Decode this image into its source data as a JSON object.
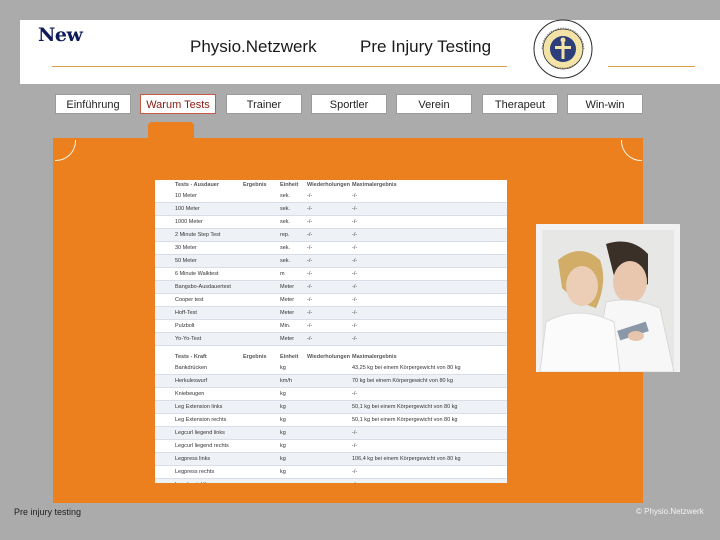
{
  "header": {
    "logo": "New",
    "title_left": "Physio.Netzwerk",
    "title_right": "Pre Injury Testing",
    "seal_text": "Physio.Netzwerk, Ihr Partner für Gesundheit"
  },
  "nav": [
    "Einführung",
    "Warum Tests",
    "Trainer",
    "Sportler",
    "Verein",
    "Therapeut",
    "Win-win"
  ],
  "nav_active": "Warum Tests",
  "table": {
    "section1_headers": [
      "Tests - Ausdauer",
      "Ergebnis",
      "Einheit",
      "Wiederholungen",
      "Maximalergebnis"
    ],
    "section1_rows": [
      [
        "10 Meter",
        "",
        "sek.",
        "-/-",
        "-/-"
      ],
      [
        "100 Meter",
        "",
        "sek.",
        "-/-",
        "-/-"
      ],
      [
        "1000 Meter",
        "",
        "sek.",
        "-/-",
        "-/-"
      ],
      [
        "2 Minute Step Test",
        "",
        "rep.",
        "-/-",
        "-/-"
      ],
      [
        "30 Meter",
        "",
        "sek.",
        "-/-",
        "-/-"
      ],
      [
        "50 Meter",
        "",
        "sek.",
        "-/-",
        "-/-"
      ],
      [
        "6 Minute Walktest",
        "",
        "m",
        "-/-",
        "-/-"
      ],
      [
        "Bangsbo-Ausdauertest",
        "",
        "Meter",
        "-/-",
        "-/-"
      ],
      [
        "Cooper test",
        "",
        "Meter",
        "-/-",
        "-/-"
      ],
      [
        "Hoff-Test",
        "",
        "Meter",
        "-/-",
        "-/-"
      ],
      [
        "Pulzbolt",
        "",
        "Min.",
        "-/-",
        "-/-"
      ],
      [
        "Yo-Yo-Test",
        "",
        "Meter",
        "-/-",
        "-/-"
      ]
    ],
    "section2_headers": [
      "Tests - Kraft",
      "Ergebnis",
      "Einheit",
      "Wiederholungen",
      "Maximalergebnis"
    ],
    "section2_rows": [
      [
        "Bankdrücken",
        "",
        "kg",
        "",
        "43,25 kg bei einem Körpergewicht von 80 kg"
      ],
      [
        "Herkuleswurf",
        "",
        "km/h",
        "",
        "70 kg bei einem Körpergewicht von 80 kg"
      ],
      [
        "Kniebeugen",
        "",
        "kg",
        "",
        "-/-"
      ],
      [
        "Leg Extension links",
        "",
        "kg",
        "",
        "50,1 kg bei einem Körpergewicht von 80 kg"
      ],
      [
        "Leg Extension rechts",
        "",
        "kg",
        "",
        "50,1 kg bei einem Körpergewicht von 80 kg"
      ],
      [
        "Legcurl liegend links",
        "",
        "kg",
        "",
        "-/-"
      ],
      [
        "Legcurl liegend rechts",
        "",
        "kg",
        "",
        "-/-"
      ],
      [
        "Legpress links",
        "",
        "kg",
        "",
        "106,4 kg bei einem Körpergewicht von 80 kg"
      ],
      [
        "Legpress rechts",
        "",
        "kg",
        "",
        "-/-"
      ],
      [
        "Langhantelübung",
        "",
        "rep.",
        "",
        "-/-"
      ]
    ]
  },
  "footer": {
    "left": "Pre injury testing",
    "right": "© Physio.Netzwerk"
  },
  "colors": {
    "orange_panel": "#ec7f1e",
    "navy_logo": "#0e1a5a",
    "gray_background": "#ababab"
  }
}
